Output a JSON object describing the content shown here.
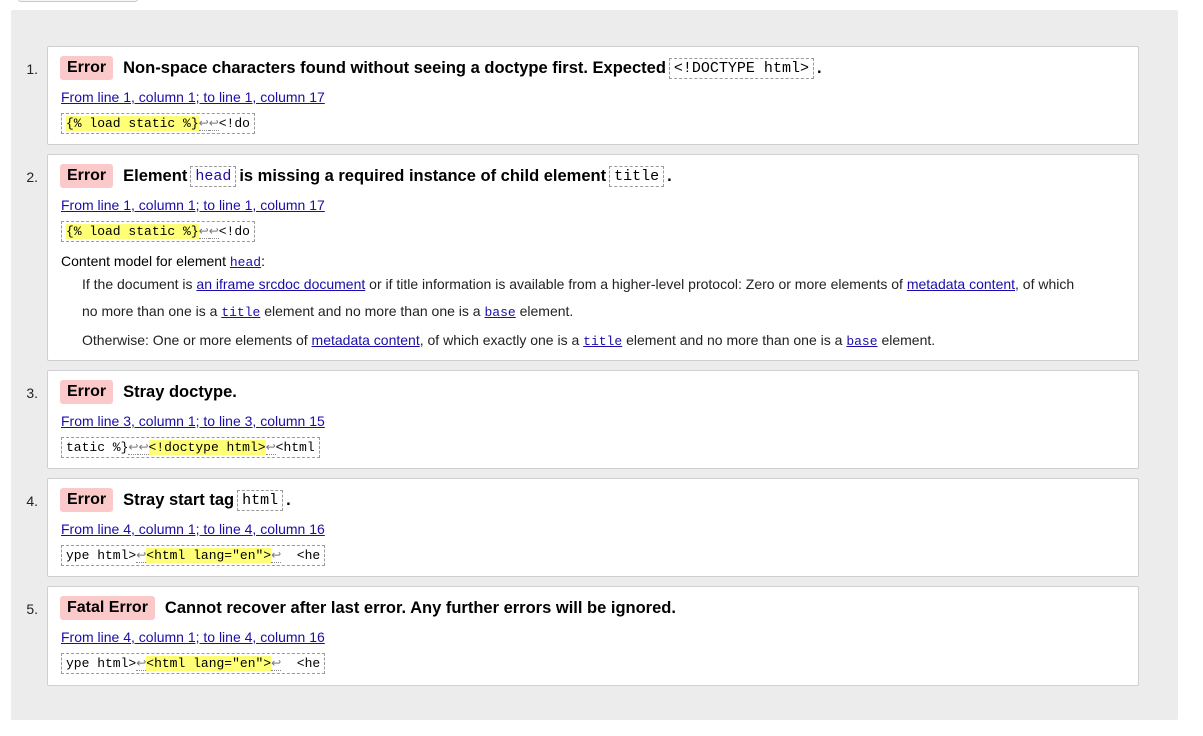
{
  "messages": [
    {
      "number": "1.",
      "type": "Error",
      "title_pre": "Non-space characters found without seeing a doctype first. Expected",
      "title_code": "<!DOCTYPE html>",
      "title_post": ".",
      "location": "From line 1, column 1; to line 1, column 17",
      "extract": {
        "highlight": "{% load static %}",
        "after": "<!do"
      }
    },
    {
      "number": "2.",
      "type": "Error",
      "title_pre": "Element",
      "title_code": "head",
      "title_mid": "is missing a required instance of child element",
      "title_code2": "title",
      "title_post": ".",
      "location": "From line 1, column 1; to line 1, column 17",
      "extract": {
        "highlight": "{% load static %}",
        "after": "<!do"
      },
      "content_model": {
        "label": "Content model for element",
        "element": "head",
        "colon": ":",
        "line1_a": "If the document is",
        "line1_link": "an iframe srcdoc document",
        "line1_b": "or if title information is available from a higher-level protocol: Zero or more elements of",
        "line1_link2": "metadata content",
        "line1_c": ", of which",
        "line2_a": "no more than one is a",
        "line2_code": "title",
        "line2_b": "element and no more than one is a",
        "line2_code2": "base",
        "line2_c": "element.",
        "line3_a": "Otherwise: One or more elements of",
        "line3_link": "metadata content",
        "line3_b": ", of which exactly one is a",
        "line3_code": "title",
        "line3_c": "element and no more than one is a",
        "line3_code2": "base",
        "line3_d": "element."
      }
    },
    {
      "number": "3.",
      "type": "Error",
      "title_pre": "Stray doctype.",
      "location": "From line 3, column 1; to line 3, column 15",
      "extract": {
        "before": "tatic %}",
        "highlight": "<!doctype html>",
        "after": "<html"
      }
    },
    {
      "number": "4.",
      "type": "Error",
      "title_pre": "Stray start tag",
      "title_code": "html",
      "title_post": ".",
      "location": "From line 4, column 1; to line 4, column 16",
      "extract": {
        "before": "ype html>",
        "highlight": "<html lang=\"en\">",
        "after": "  <he"
      }
    },
    {
      "number": "5.",
      "type": "Fatal Error",
      "title_pre": "Cannot recover after last error. Any further errors will be ignored.",
      "location": "From line 4, column 1; to line 4, column 16",
      "extract": {
        "before": "ype html>",
        "highlight": "<html lang=\"en\">",
        "after": "  <he"
      }
    }
  ],
  "return_glyph": "↩"
}
